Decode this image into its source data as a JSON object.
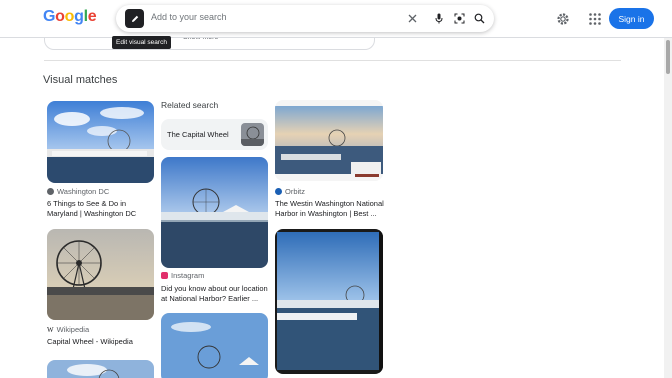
{
  "header": {
    "logo_letters": [
      {
        "ch": "G",
        "color": "#4285f4"
      },
      {
        "ch": "o",
        "color": "#ea4335"
      },
      {
        "ch": "o",
        "color": "#fbbc05"
      },
      {
        "ch": "g",
        "color": "#4285f4"
      },
      {
        "ch": "l",
        "color": "#34a853"
      },
      {
        "ch": "e",
        "color": "#ea4335"
      }
    ],
    "search_placeholder": "Add to your search",
    "tooltip": "Edit visual search",
    "signin_label": "Sign in",
    "accent": "#1a73e8"
  },
  "prev_section": {
    "show_more": "Show more"
  },
  "visual_matches": {
    "title": "Visual matches",
    "related_label": "Related search",
    "related_chip": "The Capital Wheel",
    "results": [
      {
        "source": "Washington DC",
        "title": "6 Things to See & Do in Maryland | Washington DC",
        "icon": "globe-icon"
      },
      {
        "source": "Wikipedia",
        "title": "Capital Wheel - Wikipedia",
        "icon": "wikipedia-icon"
      },
      {
        "source": "Instagram",
        "title": "Did you know about our location at National Harbor? Earlier ...",
        "icon": "instagram-icon"
      },
      {
        "source": "Orbitz",
        "title": "The Westin Washington National Harbor in Washington | Best ...",
        "icon": "orbitz-icon"
      }
    ]
  }
}
